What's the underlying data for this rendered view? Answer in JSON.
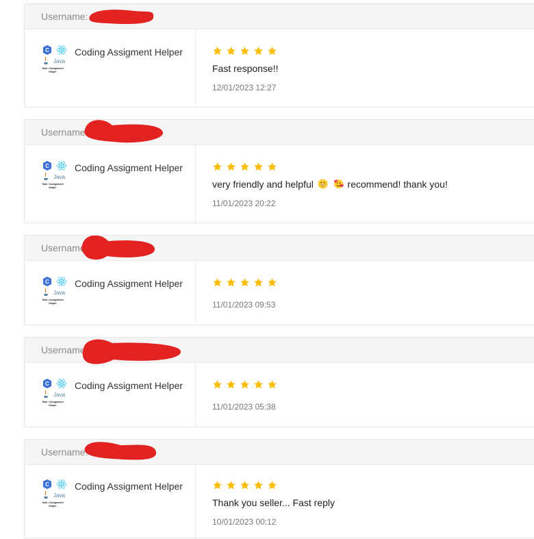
{
  "reviews": [
    {
      "username_label": "Username:",
      "product_name": "Coding Assigment Helper",
      "rating": 5,
      "comment": "Fast response!!",
      "date": "12/01/2023 12:27"
    },
    {
      "username_label": "Username:",
      "product_name": "Coding Assigment Helper",
      "rating": 5,
      "comment_part1": "very friendly and helpful",
      "emojis": [
        "grinning-face-emoji",
        "face-with-hearts-emoji"
      ],
      "comment_part2": "recommend! thank you!",
      "date": "11/01/2023 20:22"
    },
    {
      "username_label": "Username:",
      "product_name": "Coding Assigment Helper",
      "rating": 5,
      "comment": "",
      "date": "11/01/2023 09:53"
    },
    {
      "username_label": "Username:",
      "product_name": "Coding Assigment Helper",
      "rating": 5,
      "comment": "",
      "date": "11/01/2023 05:38"
    },
    {
      "username_label": "Username:",
      "product_name": "Coding Assigment Helper",
      "rating": 5,
      "comment": "Thank you seller... Fast reply",
      "date": "10/01/2023 00:12"
    }
  ],
  "thumbnail": {
    "java_label": "Java",
    "caption_line1": "Task / Assignment",
    "caption_line2": "Helper"
  },
  "colors": {
    "star": "#fbbd08",
    "redaction": "#e32222",
    "header_bg": "#f5f5f5"
  }
}
